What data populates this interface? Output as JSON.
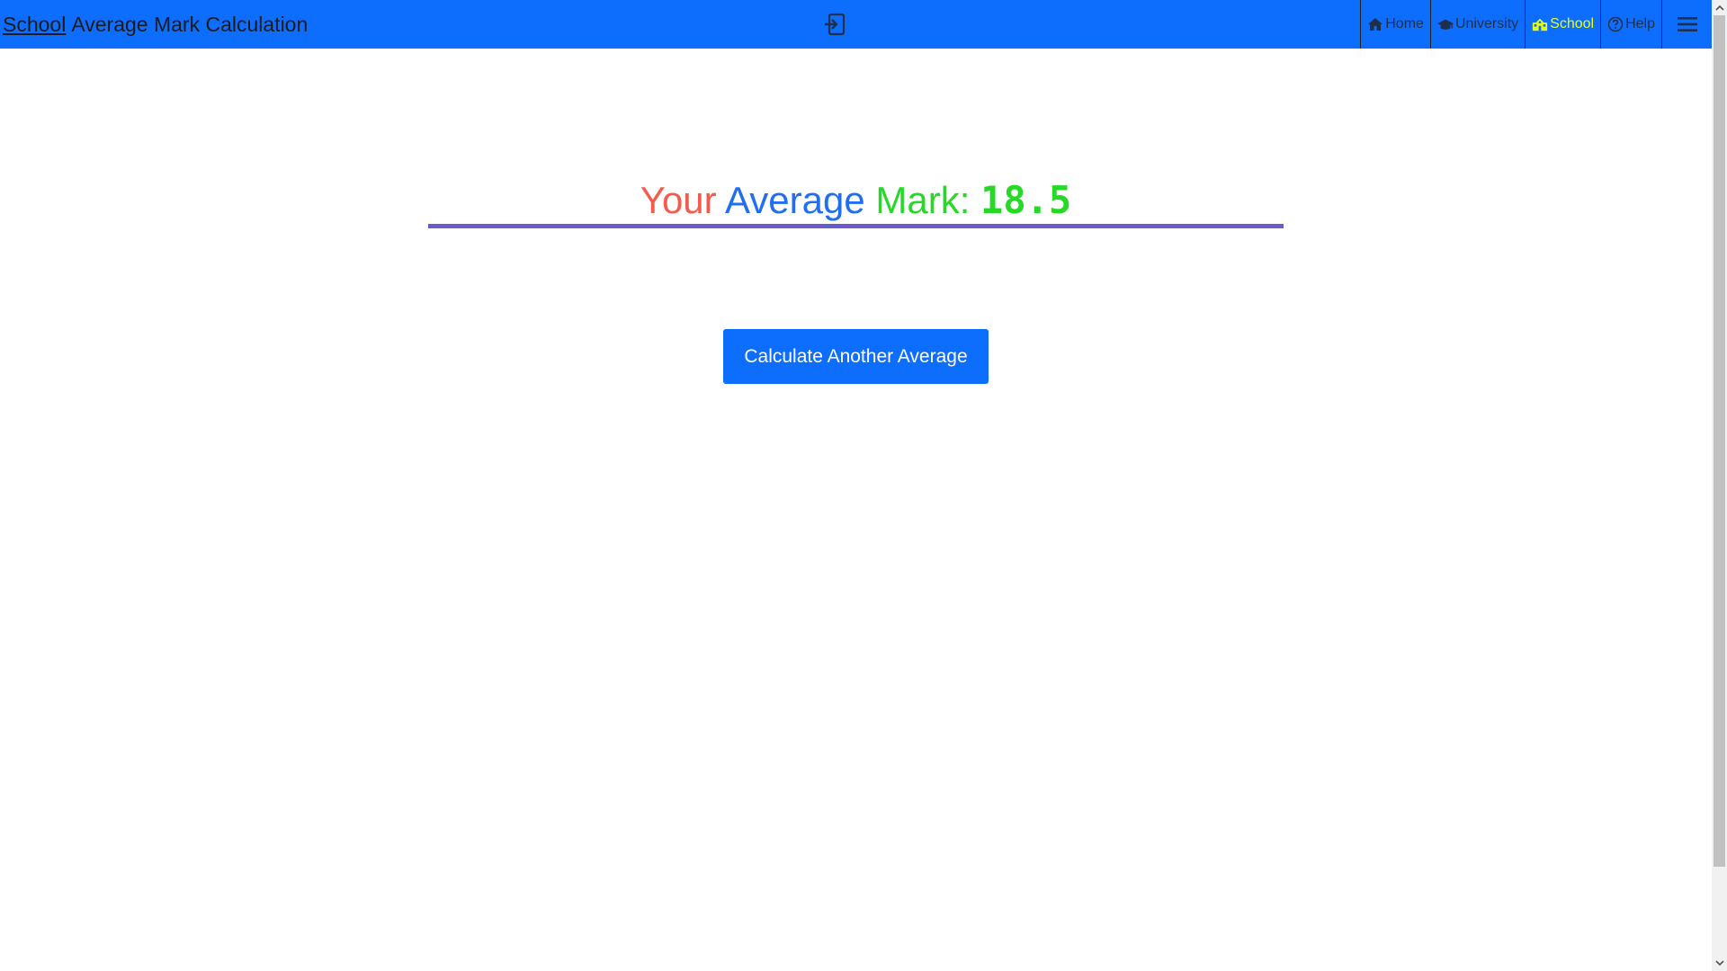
{
  "header": {
    "brand_link": "School",
    "brand_rest": "Average Mark Calculation",
    "logout_icon": "sign-out-icon",
    "nav": {
      "home": "Home",
      "university": "University",
      "school": "School",
      "help": "Help"
    },
    "menu_icon": "hamburger-menu-icon"
  },
  "result": {
    "word_your": "Your",
    "word_average": "Average",
    "word_mark": "Mark:",
    "value": "18.5"
  },
  "actions": {
    "calculate_again_label": "Calculate Another Average"
  },
  "colors": {
    "navbar_bg": "#0d6efd",
    "active_nav": "#e6ff1f",
    "your": "#f25c4c",
    "average": "#1f6ff0",
    "mark": "#27d927",
    "underline": "#6a5acd",
    "button_bg": "#0d6efd"
  }
}
